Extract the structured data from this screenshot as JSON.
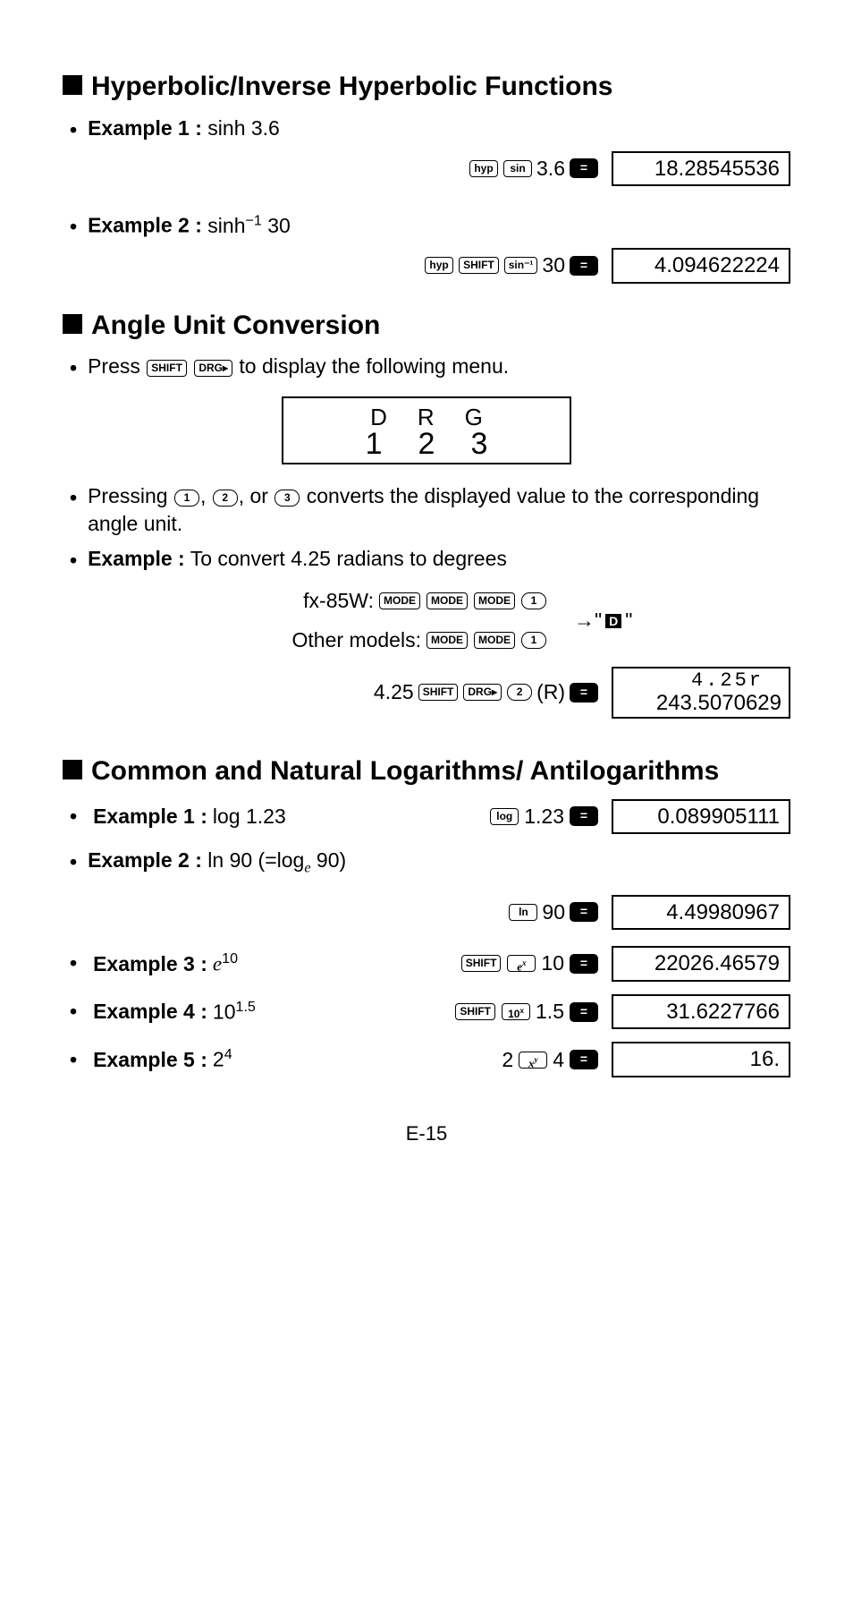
{
  "page_number": "E-15",
  "sections": {
    "hyp": {
      "title": "Hyperbolic/Inverse Hyperbolic Functions",
      "ex1": {
        "label": "Example 1 :",
        "problem": "sinh 3.6",
        "input_num": "3.6",
        "result": "18.28545536"
      },
      "ex2": {
        "label": "Example 2 :",
        "problem": "sinh⁻¹ 30",
        "input_num": "30",
        "result": "4.094622224"
      }
    },
    "angle": {
      "title": "Angle Unit Conversion",
      "press_text_a": "Press ",
      "press_text_b": " to display the following menu.",
      "drg_top": "D   R   G",
      "drg_bot": "1   2   3",
      "pressing_text_a": "Pressing ",
      "pressing_text_b": " converts the displayed value to the corresponding angle unit.",
      "ex_label": "Example :",
      "ex_problem": "To convert 4.25 radians to degrees",
      "fx85w_label": "fx-85W:",
      "other_label": "Other models:",
      "d_symbol": "D",
      "seq_input": "4.25",
      "seq_r": "(R)",
      "result_upper": "4.25r",
      "result_lower": "243.5070629"
    },
    "log": {
      "title": "Common and  Natural Logarithms/ Antilogarithms",
      "ex1": {
        "label": "Example 1 :",
        "problem": "log 1.23",
        "input": "1.23",
        "result": "0.089905111"
      },
      "ex2": {
        "label": "Example 2 :",
        "problem_a": "ln 90 (=log",
        "problem_b": " 90)",
        "input": "90",
        "result": "4.49980967"
      },
      "ex3": {
        "label": "Example 3 :",
        "input": "10",
        "result": "22026.46579"
      },
      "ex4": {
        "label": "Example 4 :",
        "problem": "10",
        "exp": "1.5",
        "input": "1.5",
        "result": "31.6227766"
      },
      "ex5": {
        "label": "Example 5 :",
        "problem": "2",
        "exp": "4",
        "input_a": "2",
        "input_b": "4",
        "result": "16."
      }
    },
    "keys": {
      "hyp": "hyp",
      "sin": "sin",
      "shift": "SHIFT",
      "sin1": "sin⁻¹",
      "drg": "DRG▸",
      "mode": "MODE",
      "k1": "1",
      "k2": "2",
      "k3": "3",
      "log": "log",
      "ln": "ln",
      "ex": "eˣ",
      "tenx": "10ˣ",
      "xy": "xʸ",
      "comma": ",",
      "or": ", or "
    }
  }
}
